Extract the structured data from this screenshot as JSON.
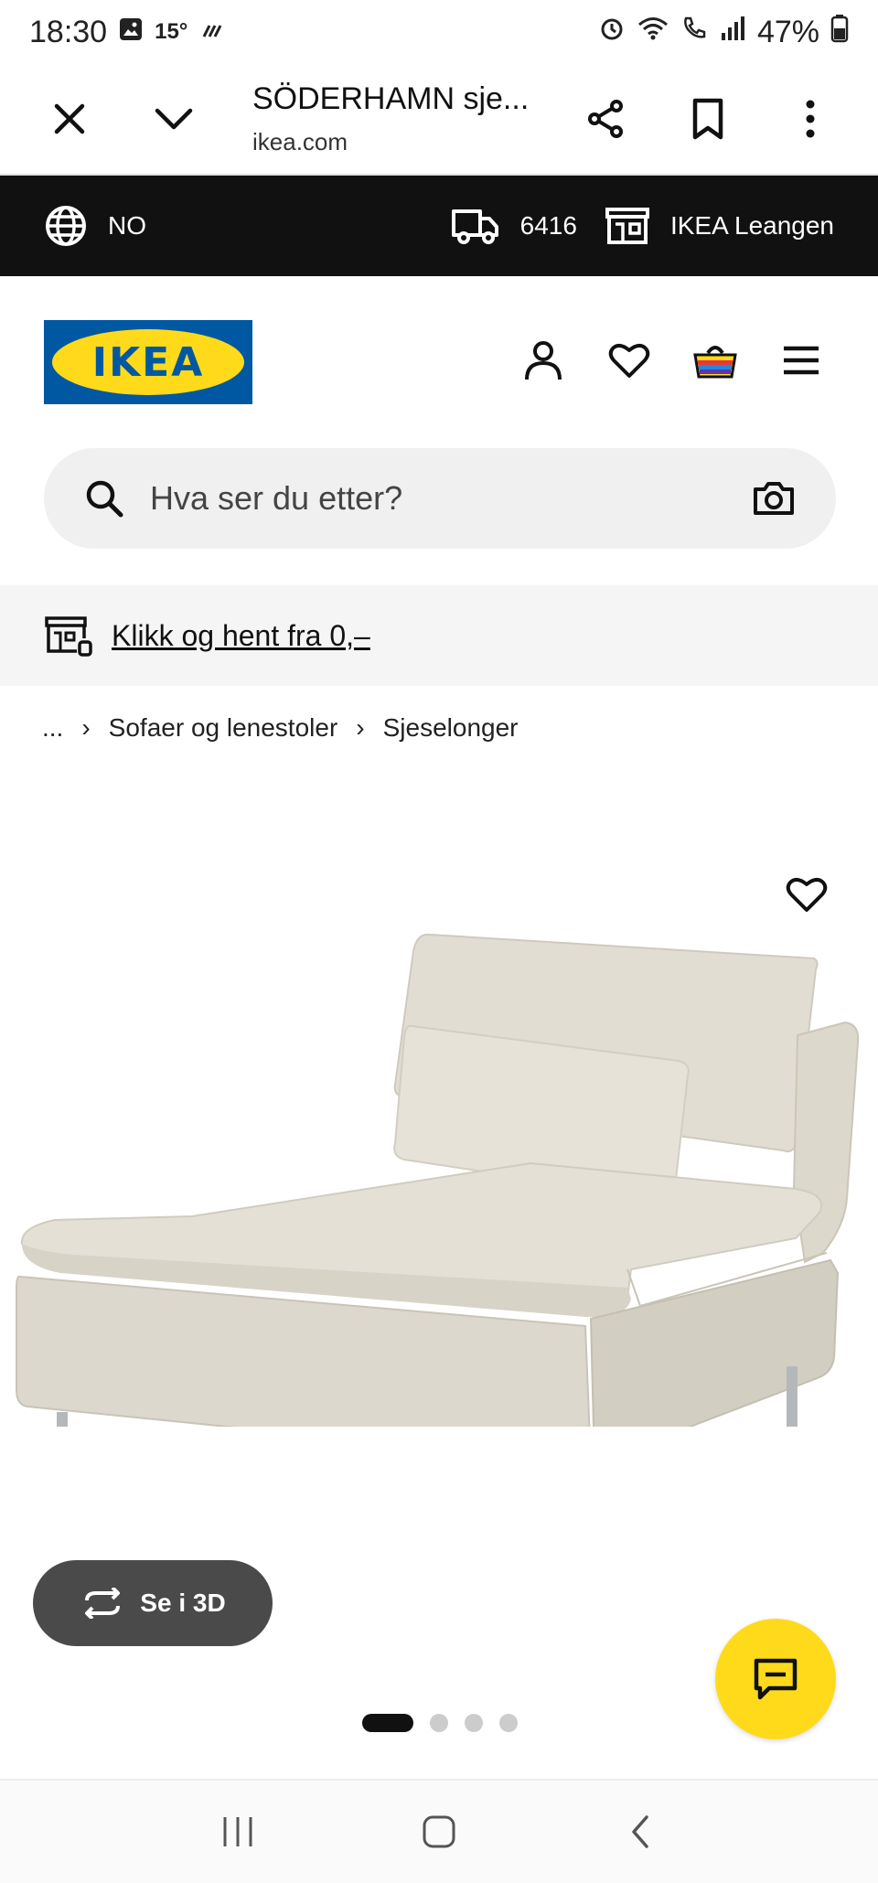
{
  "status_bar": {
    "time": "18:30",
    "temperature": "15°",
    "battery": "47%"
  },
  "browser": {
    "title": "SÖDERHAMN sje...",
    "url": "ikea.com"
  },
  "location_bar": {
    "country": "NO",
    "postcode": "6416",
    "store": "IKEA Leangen"
  },
  "header": {
    "logo_text": "IKEA",
    "brand_colors": {
      "blue": "#0058A3",
      "yellow": "#FFDA1A"
    }
  },
  "search": {
    "placeholder": "Hva ser du etter?"
  },
  "promo": {
    "text": "Klikk og hent fra 0,–"
  },
  "breadcrumb": {
    "ellipsis": "...",
    "items": [
      "Sofaer og lenestoler",
      "Sjeselonger"
    ],
    "separator": "›"
  },
  "product": {
    "view_3d_label": "Se i 3D",
    "image_count": 4,
    "active_image": 1
  },
  "icons": {
    "close": "close-icon",
    "chevron": "chevron-down-icon",
    "share": "share-icon",
    "bookmark": "bookmark-icon",
    "more": "more-vertical-icon",
    "globe": "globe-icon",
    "truck": "truck-icon",
    "store": "store-icon",
    "profile": "profile-icon",
    "heart": "heart-icon",
    "basket": "basket-icon",
    "menu": "hamburger-icon",
    "search": "search-icon",
    "camera": "camera-icon",
    "rotate": "rotate-3d-icon",
    "chat": "chat-icon"
  }
}
